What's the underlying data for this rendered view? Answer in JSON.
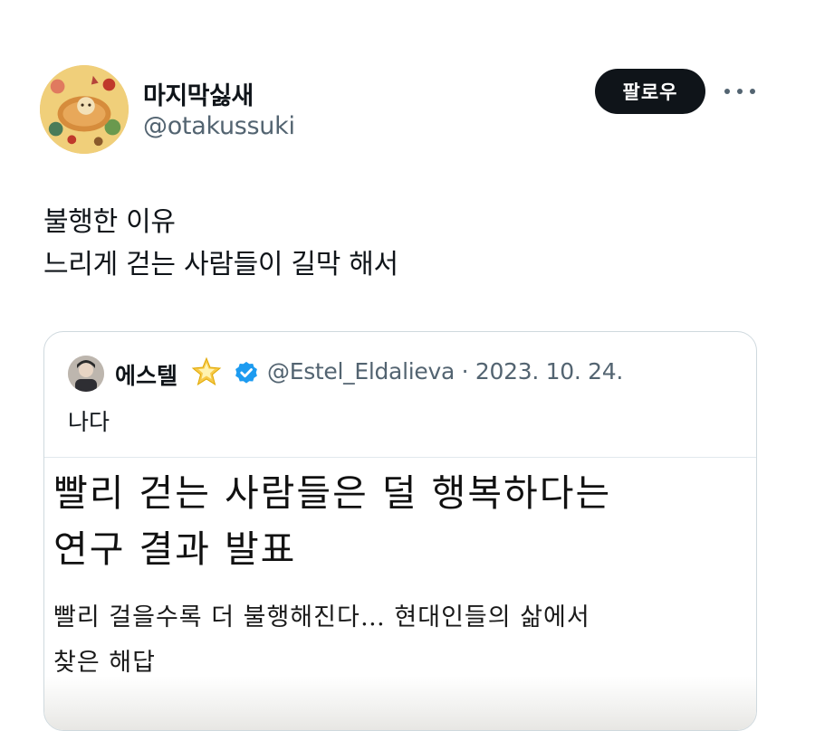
{
  "author": {
    "display_name": "마지막싫새",
    "handle": "@otakussuki",
    "avatar_icon": "taiyaki-avatar-icon"
  },
  "actions": {
    "follow_label": "팔로우",
    "more_icon": "more-horizontal-icon"
  },
  "tweet": {
    "lines": [
      "불행한 이유",
      "느리게 걷는 사람들이 길막 해서"
    ]
  },
  "quoted_tweet": {
    "display_name": "에스텔",
    "name_emoji": "glowing-star-icon",
    "verified_icon": "verified-badge-icon",
    "handle_date": "@Estel_Eldalieva · 2023. 10. 24.",
    "text": "나다",
    "image": {
      "headline_lines": [
        "빨리 걷는 사람들은 덜 행복하다는",
        "연구 결과 발표"
      ],
      "subhead_lines": [
        "빨리 걸을수록 더 불행해진다… 현대인들의 삶에서",
        "찾은 해답"
      ]
    }
  },
  "colors": {
    "text_primary": "#0f1419",
    "text_secondary": "#536471",
    "follow_bg": "#0f1419",
    "verified_blue": "#1d9bf0",
    "border": "#cfd9de"
  }
}
